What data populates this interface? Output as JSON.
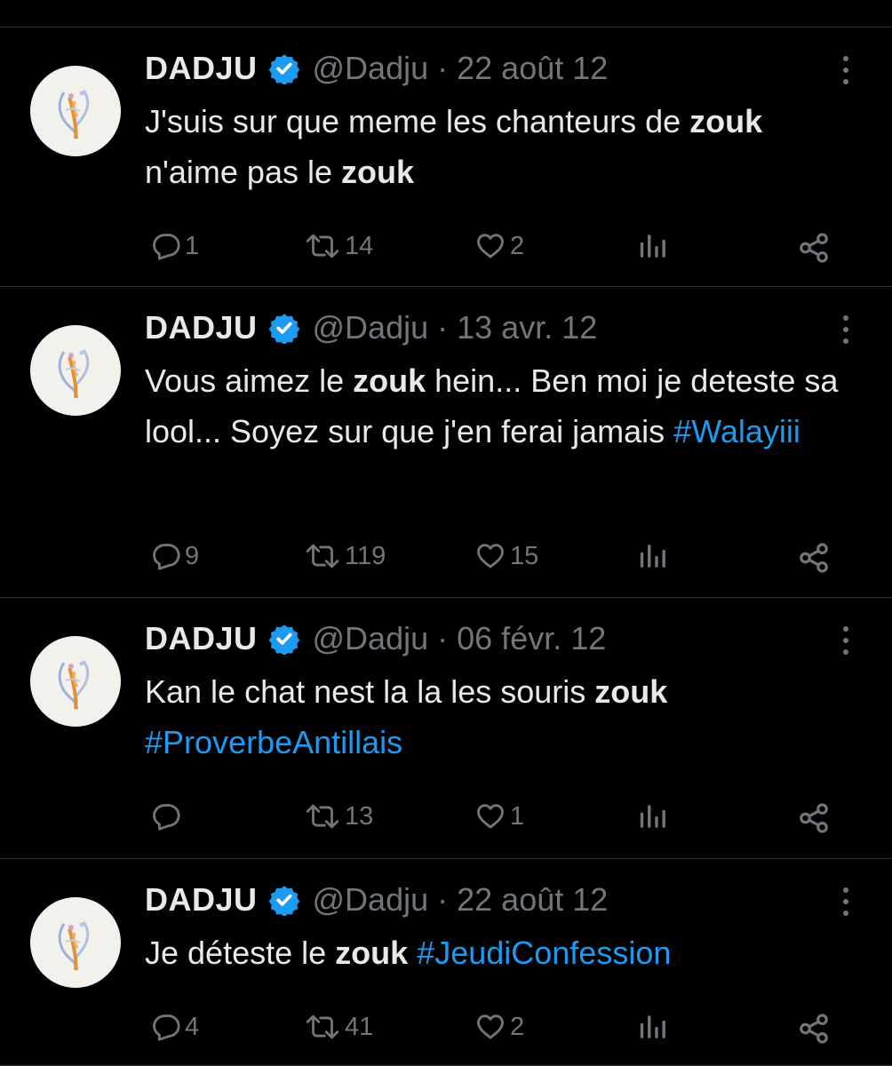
{
  "colors": {
    "background": "#000000",
    "text": "#e7e9ea",
    "muted": "#71767b",
    "accent": "#1d9bf0",
    "divider": "#2f3336"
  },
  "icons": [
    "avatar-image",
    "verified-badge-icon",
    "more-options-icon",
    "reply-icon",
    "retweet-icon",
    "like-icon",
    "views-icon",
    "share-icon"
  ],
  "tweets": [
    {
      "name": "DADJU",
      "handle": "@Dadju",
      "separator": "·",
      "date": "22 août 12",
      "text": [
        {
          "t": "J'suis sur que meme les chanteurs de ",
          "k": "plain"
        },
        {
          "t": "zouk",
          "k": "bold"
        },
        {
          "t": " n'aime pas le ",
          "k": "plain"
        },
        {
          "t": "zouk",
          "k": "bold"
        }
      ],
      "replies": "1",
      "retweets": "14",
      "likes": "2"
    },
    {
      "name": "DADJU",
      "handle": "@Dadju",
      "separator": "·",
      "date": "13 avr. 12",
      "text": [
        {
          "t": "Vous aimez le ",
          "k": "plain"
        },
        {
          "t": "zouk",
          "k": "bold"
        },
        {
          "t": " hein... Ben moi je deteste sa lool... Soyez sur que j'en ferai jamais ",
          "k": "plain"
        },
        {
          "t": "#Walayiii",
          "k": "hashtag"
        }
      ],
      "replies": "9",
      "retweets": "119",
      "likes": "15"
    },
    {
      "name": "DADJU",
      "handle": "@Dadju",
      "separator": "·",
      "date": "06 févr. 12",
      "text": [
        {
          "t": "Kan le chat nest la la les souris ",
          "k": "plain"
        },
        {
          "t": "zouk",
          "k": "bold"
        },
        {
          "t": " ",
          "k": "plain"
        },
        {
          "t": "#ProverbeAntillais",
          "k": "hashtag"
        }
      ],
      "replies": "",
      "retweets": "13",
      "likes": "1"
    },
    {
      "name": "DADJU",
      "handle": "@Dadju",
      "separator": "·",
      "date": "22 août 12",
      "text": [
        {
          "t": "Je déteste le ",
          "k": "plain"
        },
        {
          "t": "zouk",
          "k": "bold"
        },
        {
          "t": " ",
          "k": "plain"
        },
        {
          "t": "#JeudiConfession",
          "k": "hashtag"
        }
      ],
      "replies": "4",
      "retweets": "41",
      "likes": "2"
    }
  ]
}
